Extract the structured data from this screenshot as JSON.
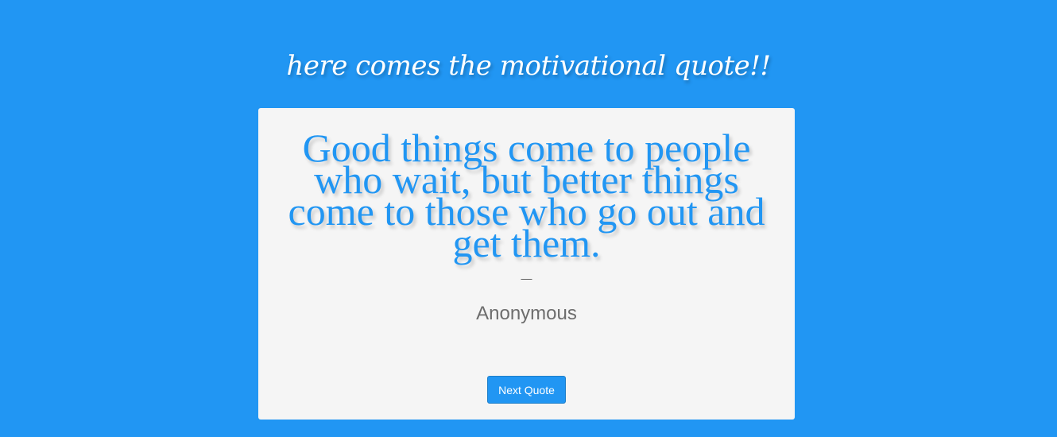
{
  "header": {
    "title": "here comes the motivational quote!!"
  },
  "quote": {
    "text": "Good things come to people who wait, but better things come to those who go out and get them.",
    "dash": "—",
    "author": "Anonymous"
  },
  "actions": {
    "next_label": "Next Quote"
  },
  "colors": {
    "background": "#2196f3",
    "card": "#f5f5f5",
    "quote_text": "#2196f3",
    "author_text": "#6d6d6d"
  }
}
